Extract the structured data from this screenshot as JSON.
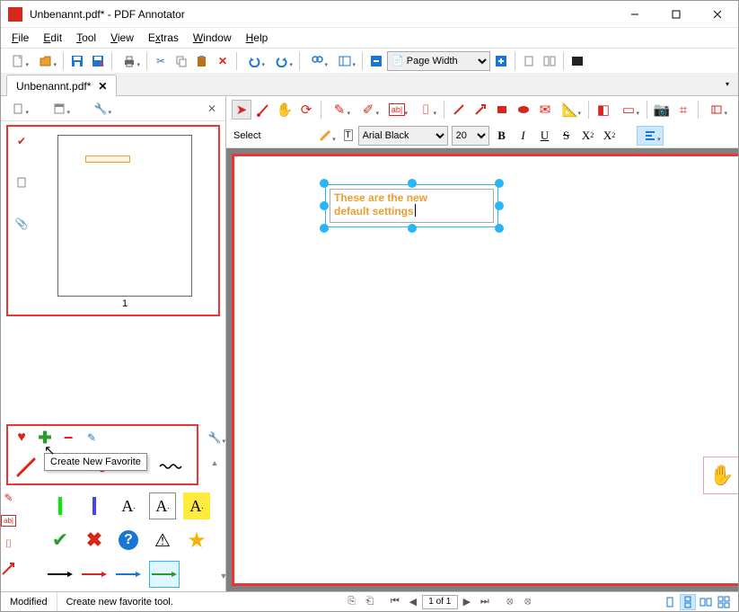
{
  "window": {
    "title": "Unbenannt.pdf* - PDF Annotator"
  },
  "menu": {
    "file": "File",
    "edit": "Edit",
    "tool": "Tool",
    "view": "View",
    "extras": "Extras",
    "window": "Window",
    "help": "Help"
  },
  "toolbar": {
    "zoom_mode": "Page Width"
  },
  "tab": {
    "name": "Unbenannt.pdf*"
  },
  "left_panel": {
    "thumb_page_num": "1"
  },
  "favorites": {
    "tooltip": "Create New Favorite"
  },
  "right_panel": {
    "tool_label": "Select",
    "font_name": "Arial Black",
    "font_size": "20",
    "textbox_line1": "These are the new",
    "textbox_line2": "default settings"
  },
  "statusbar": {
    "status": "Modified",
    "hint": "Create new favorite tool.",
    "page": "1 of 1"
  }
}
